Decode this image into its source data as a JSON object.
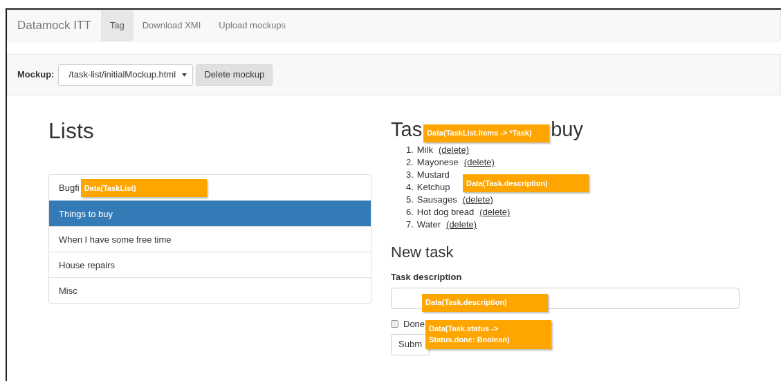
{
  "navbar": {
    "brand": "Datamock ITT",
    "tabs": [
      {
        "label": "Tag",
        "selected": true
      },
      {
        "label": "Download XMI",
        "selected": false
      },
      {
        "label": "Upload mockups",
        "selected": false
      }
    ]
  },
  "mockup_bar": {
    "label": "Mockup:",
    "select_value": "/task-list/initialMockup.html",
    "delete_button": "Delete mockup"
  },
  "lists": {
    "title": "Lists",
    "items": [
      {
        "label": "Bugfi",
        "selected": false,
        "annotation": "Data(TaskList)"
      },
      {
        "label": "Things to buy",
        "selected": true
      },
      {
        "label": "When I have some free time",
        "selected": false
      },
      {
        "label": "House repairs",
        "selected": false
      },
      {
        "label": "Misc",
        "selected": false
      }
    ]
  },
  "task_list": {
    "title_start": "Tas",
    "title_annotation": "Data(TaskList.items -> *Task)",
    "title_end": "buy",
    "items": [
      {
        "number": "1.",
        "text": "Milk",
        "delete_link": "(delete)"
      },
      {
        "number": "2.",
        "text": "Mayonese",
        "delete_link": "(delete)"
      },
      {
        "number": "3.",
        "text": "Mustard"
      },
      {
        "number": "4.",
        "text": "Ketchup",
        "annotation": "Data(Task.description)"
      },
      {
        "number": "5.",
        "text": "Sausages",
        "delete_link": "(delete)"
      },
      {
        "number": "6.",
        "text": "Hot dog bread",
        "delete_link": "(delete)"
      },
      {
        "number": "7.",
        "text": "Water",
        "delete_link": "(delete)"
      }
    ]
  },
  "new_task": {
    "title": "New task",
    "field_label": "Task description",
    "field_annotation": "Data(Task.description)",
    "checkbox": {
      "label": "Done",
      "checked": false
    },
    "submit_button": "Subm",
    "form_annotation": "Data(Task.status -> Status.done: Boolean)"
  }
}
